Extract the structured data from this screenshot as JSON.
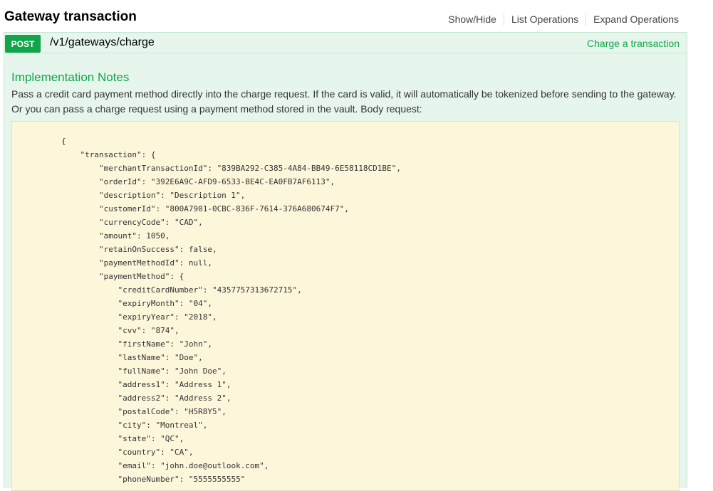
{
  "header": {
    "title": "Gateway transaction",
    "actions": [
      "Show/Hide",
      "List Operations",
      "Expand Operations"
    ]
  },
  "operation": {
    "method": "POST",
    "path": "/v1/gateways/charge",
    "summary": "Charge a transaction"
  },
  "notes": {
    "title": "Implementation Notes",
    "text": "Pass a credit card payment method directly into the charge request. If the card is valid, it will automatically be tokenized before sending to the gateway. Or you can pass a charge request using a payment method stored in the vault. Body request:"
  },
  "code_lines": [
    {
      "indent": 0,
      "text": "{"
    },
    {
      "indent": 1,
      "text": "\"transaction\": {"
    },
    {
      "indent": 2,
      "text": "\"merchantTransactionId\": \"839BA292-C385-4A84-BB49-6E58118CD1BE\","
    },
    {
      "indent": 2,
      "text": "\"orderId\": \"392E6A9C-AFD9-6533-BE4C-EA0FB7AF6113\","
    },
    {
      "indent": 2,
      "text": "\"description\": \"Description 1\","
    },
    {
      "indent": 2,
      "text": "\"customerId\": \"800A7901-0CBC-836F-7614-376A680674F7\","
    },
    {
      "indent": 2,
      "text": "\"currencyCode\": \"CAD\","
    },
    {
      "indent": 2,
      "text": "\"amount\": 1050,"
    },
    {
      "indent": 2,
      "text": "\"retainOnSuccess\": false,"
    },
    {
      "indent": 2,
      "text": "\"paymentMethodId\": null,"
    },
    {
      "indent": 2,
      "text": "\"paymentMethod\": {"
    },
    {
      "indent": 3,
      "text": "\"creditCardNumber\": \"4357757313672715\","
    },
    {
      "indent": 3,
      "text": "\"expiryMonth\": \"04\","
    },
    {
      "indent": 3,
      "text": "\"expiryYear\": \"2018\","
    },
    {
      "indent": 3,
      "text": "\"cvv\": \"874\","
    },
    {
      "indent": 3,
      "text": "\"firstName\": \"John\","
    },
    {
      "indent": 3,
      "text": "\"lastName\": \"Doe\","
    },
    {
      "indent": 3,
      "text": "\"fullName\": \"John Doe\","
    },
    {
      "indent": 3,
      "text": "\"address1\": \"Address 1\","
    },
    {
      "indent": 3,
      "text": "\"address2\": \"Address 2\","
    },
    {
      "indent": 3,
      "text": "\"postalCode\": \"H5R8Y5\","
    },
    {
      "indent": 3,
      "text": "\"city\": \"Montreal\","
    },
    {
      "indent": 3,
      "text": "\"state\": \"QC\","
    },
    {
      "indent": 3,
      "text": "\"country\": \"CA\","
    },
    {
      "indent": 3,
      "text": "\"email\": \"john.doe@outlook.com\","
    },
    {
      "indent": 3,
      "text": "\"phoneNumber\": \"5555555555\""
    }
  ]
}
